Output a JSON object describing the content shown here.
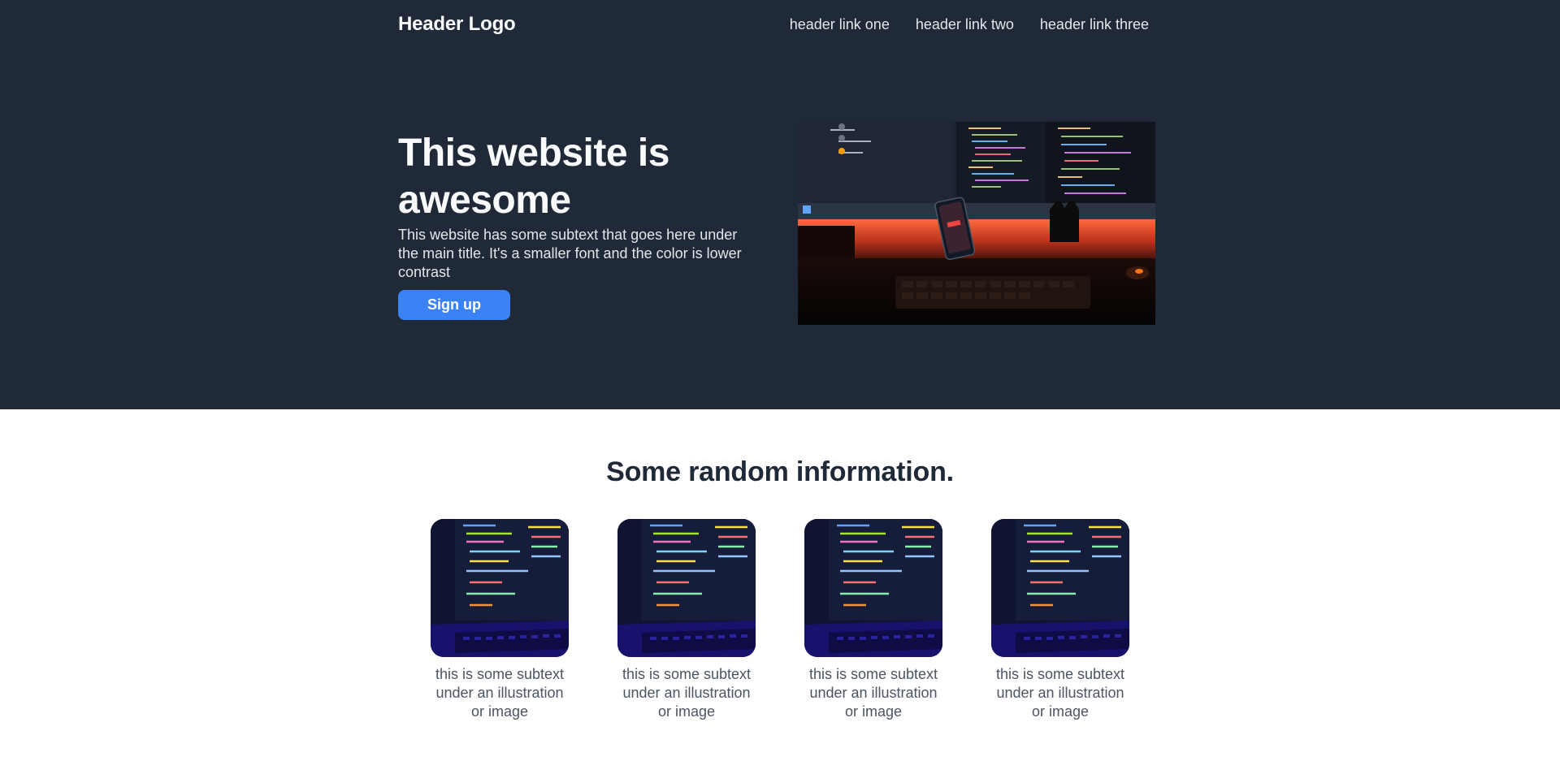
{
  "header": {
    "logo": "Header Logo",
    "links": [
      "header link one",
      "header link two",
      "header link three"
    ]
  },
  "hero": {
    "title": "This website is awesome",
    "subtext": "This website has some subtext that goes here under the main title. It's a smaller font and the color is lower contrast",
    "cta_label": "Sign up",
    "image_icon": "desk-setup-photo"
  },
  "info": {
    "title": "Some random information.",
    "cards": [
      {
        "text": "this is some subtext under an illustration or image",
        "image_icon": "laptop-code-photo"
      },
      {
        "text": "this is some subtext under an illustration or image",
        "image_icon": "laptop-code-photo"
      },
      {
        "text": "this is some subtext under an illustration or image",
        "image_icon": "laptop-code-photo"
      },
      {
        "text": "this is some subtext under an illustration or image",
        "image_icon": "laptop-code-photo"
      }
    ]
  },
  "colors": {
    "hero_bg": "#1f2937",
    "accent": "#3b82f6",
    "text_light": "#f9fafb",
    "text_muted": "#4b5563"
  }
}
